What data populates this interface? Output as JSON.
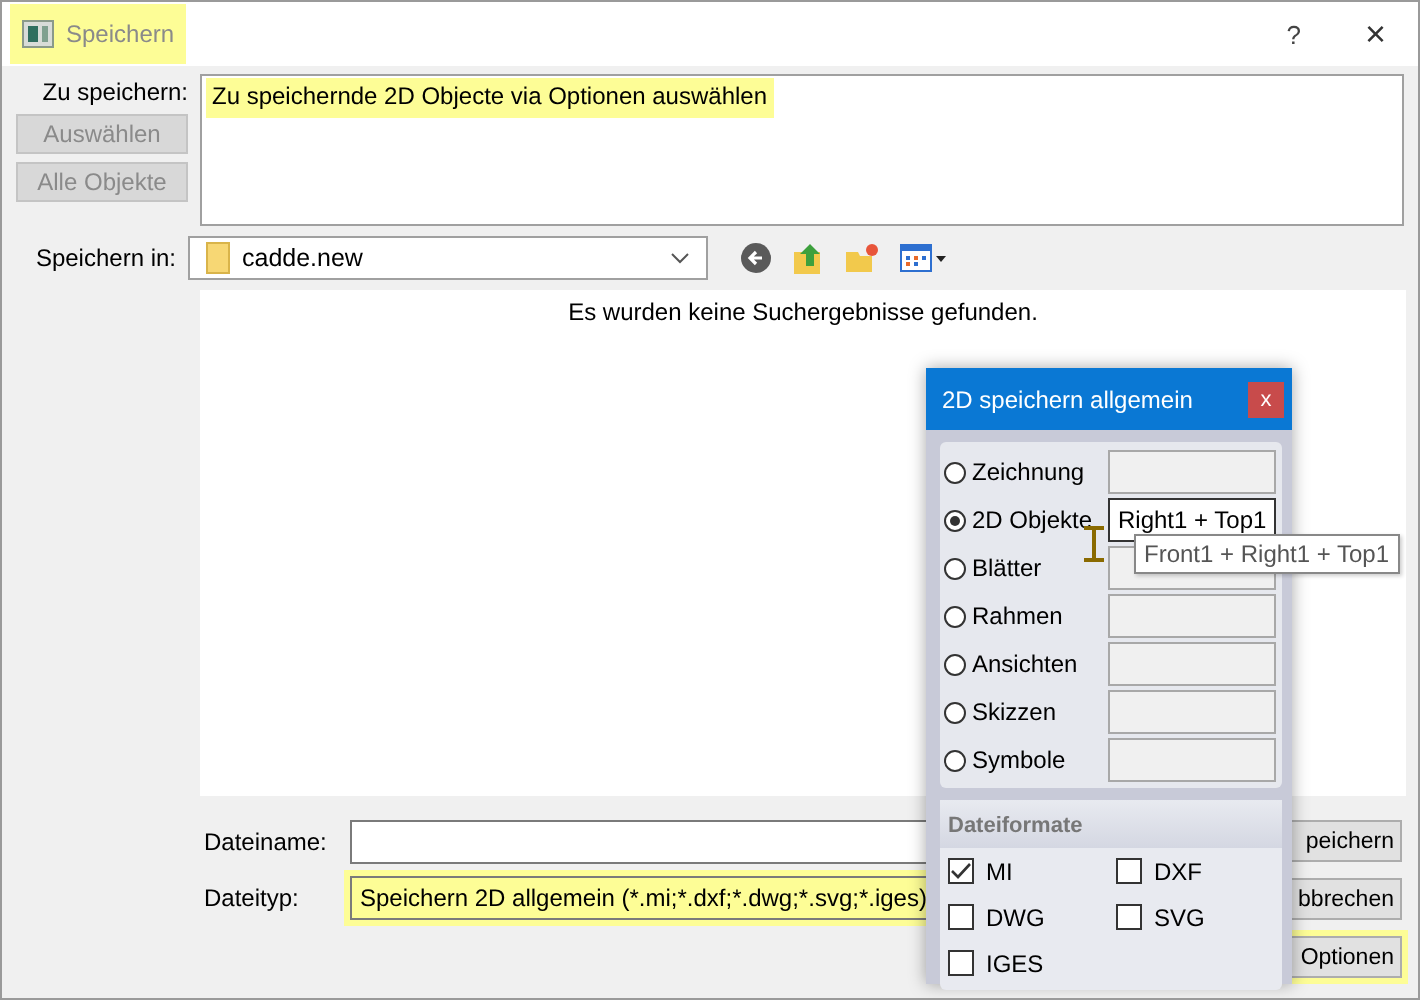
{
  "window": {
    "title": "Speichern",
    "highlighted": true,
    "help": "?",
    "close": "×"
  },
  "selection": {
    "label": "Zu speichern:",
    "text": "Zu speichernde 2D Objecte via Optionen auswählen",
    "highlighted": true,
    "buttons": [
      {
        "label": "Auswählen",
        "disabled": true
      },
      {
        "label": "Alle Objekte",
        "disabled": true
      }
    ]
  },
  "location": {
    "label": "Speichern in:",
    "folder": "cadde.new"
  },
  "results": {
    "message": "Es wurden keine Suchergebnisse gefunden."
  },
  "filename": {
    "label": "Dateiname:"
  },
  "filetype": {
    "label": "Dateityp:",
    "value": "Speichern 2D allgemein (*.mi;*.dxf;*.dwg;*.svg;*.iges)",
    "highlighted": true
  },
  "buttons": [
    {
      "label": "peichern",
      "highlighted": false
    },
    {
      "label": "bbrechen",
      "highlighted": false
    },
    {
      "label": "Optionen",
      "highlighted": true
    }
  ],
  "popup": {
    "title": "2D speichern allgemein",
    "close": "x",
    "options": [
      {
        "label": "Zeichnung",
        "selected": false
      },
      {
        "label": "2D Objekte",
        "selected": true,
        "value": "Right1 + Top1"
      },
      {
        "label": "Blätter",
        "selected": false
      },
      {
        "label": "Rahmen",
        "selected": false
      },
      {
        "label": "Ansichten",
        "selected": false
      },
      {
        "label": "Skizzen",
        "selected": false
      },
      {
        "label": "Symbole",
        "selected": false
      }
    ],
    "formats_title": "Dateiformate",
    "formats": [
      {
        "label": "MI",
        "checked": true
      },
      {
        "label": "DXF",
        "checked": false
      },
      {
        "label": "DWG",
        "checked": false
      },
      {
        "label": "SVG",
        "checked": false
      },
      {
        "label": "IGES",
        "checked": false
      }
    ],
    "tooltip": "Front1 + Right1 + Top1"
  }
}
